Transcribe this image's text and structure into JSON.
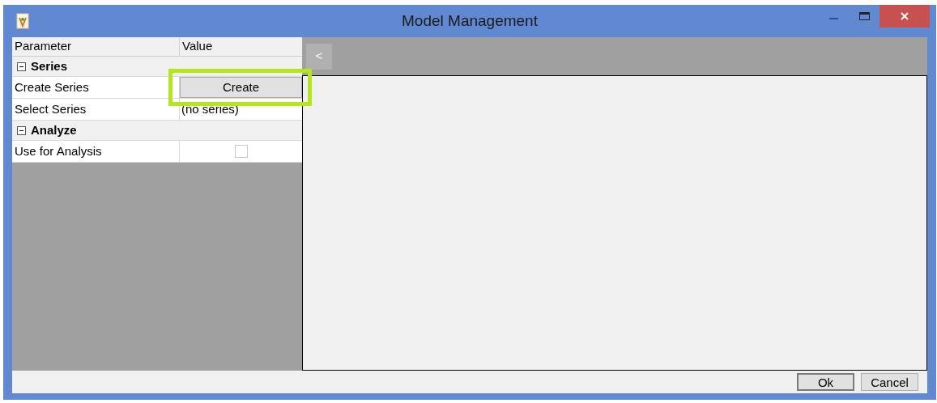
{
  "window": {
    "title": "Model Management"
  },
  "grid": {
    "columns": [
      "Parameter",
      "Value"
    ],
    "groups": [
      {
        "label": "Series",
        "expanded": true,
        "rows": [
          {
            "name": "Create Series",
            "kind": "button",
            "value": "Create",
            "highlighted": true
          },
          {
            "name": "Select Series",
            "kind": "text",
            "value": "(no series)"
          }
        ]
      },
      {
        "label": "Analyze",
        "expanded": true,
        "rows": [
          {
            "name": "Use for Analysis",
            "kind": "checkbox",
            "checked": false
          }
        ]
      }
    ]
  },
  "collapse_button": "<",
  "buttons": [
    "Ok",
    "Cancel"
  ]
}
